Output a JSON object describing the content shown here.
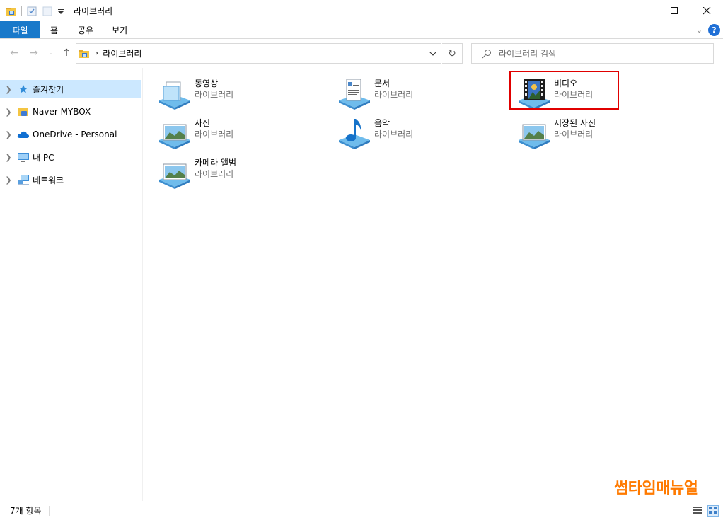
{
  "window": {
    "title": "라이브러리"
  },
  "ribbon": {
    "tabs": [
      "파일",
      "홈",
      "공유",
      "보기"
    ],
    "help_label": "?"
  },
  "address": {
    "path": "라이브러리",
    "separator": "›"
  },
  "search": {
    "placeholder": "라이브러리 검색"
  },
  "sidebar": {
    "items": [
      {
        "label": "즐겨찾기",
        "icon": "star-icon"
      },
      {
        "label": "Naver MYBOX",
        "icon": "mybox-icon"
      },
      {
        "label": "OneDrive - Personal",
        "icon": "onedrive-icon"
      },
      {
        "label": "내 PC",
        "icon": "pc-icon"
      },
      {
        "label": "네트워크",
        "icon": "network-icon"
      }
    ]
  },
  "libraries": [
    {
      "name": "동영상",
      "type": "라이브러리",
      "icon": "videos-library-icon"
    },
    {
      "name": "문서",
      "type": "라이브러리",
      "icon": "documents-library-icon"
    },
    {
      "name": "비디오",
      "type": "라이브러리",
      "icon": "video-film-library-icon"
    },
    {
      "name": "사진",
      "type": "라이브러리",
      "icon": "pictures-library-icon"
    },
    {
      "name": "음악",
      "type": "라이브러리",
      "icon": "music-library-icon"
    },
    {
      "name": "저장된 사진",
      "type": "라이브러리",
      "icon": "saved-pictures-library-icon"
    },
    {
      "name": "카메라 앨범",
      "type": "라이브러리",
      "icon": "camera-roll-library-icon"
    }
  ],
  "status": {
    "item_count": "7개 항목"
  },
  "watermark": "썸타임매뉴얼",
  "colors": {
    "accent": "#1979ca",
    "selection": "#cce8ff",
    "highlight_box": "#e00000",
    "watermark": "#ff7a00"
  }
}
